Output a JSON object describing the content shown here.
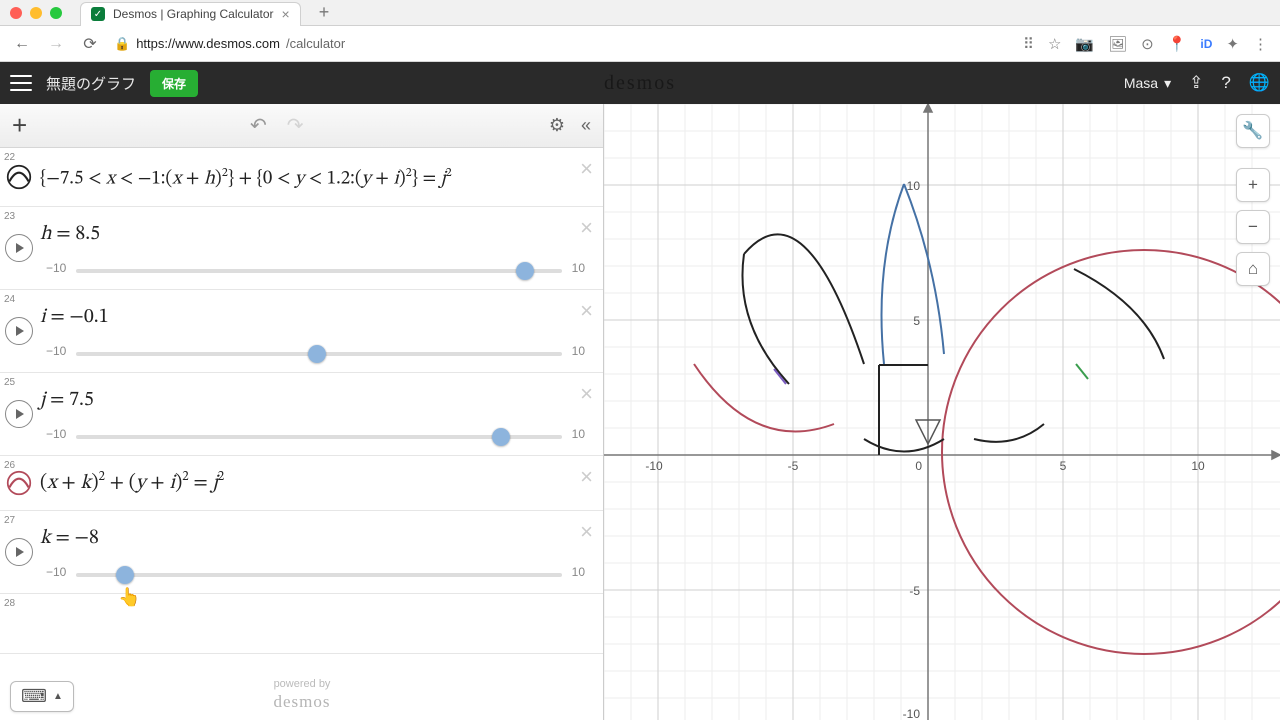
{
  "browser": {
    "tab_title": "Desmos | Graphing Calculator",
    "url_host": "https://www.desmos.com",
    "url_path": "/calculator"
  },
  "header": {
    "untitled": "無題のグラフ",
    "save": "保存",
    "brand": "desmos",
    "user": "Masa"
  },
  "toolbar": {
    "add": "+"
  },
  "exprs": {
    "row22": {
      "num": "22",
      "latex": "{ −7.5 < x < −1 : (x + h)² } + { 0 < y < 1.2 : (y + i)² } = j²"
    },
    "row23": {
      "num": "23",
      "var": "h",
      "valtext": "h = 8.5",
      "value": 8.5,
      "min": "−10",
      "max": "10"
    },
    "row24": {
      "num": "24",
      "var": "i",
      "valtext": "i = −0.1",
      "value": -0.1,
      "min": "−10",
      "max": "10"
    },
    "row25": {
      "num": "25",
      "var": "j",
      "valtext": "j = 7.5",
      "value": 7.5,
      "min": "−10",
      "max": "10"
    },
    "row26": {
      "num": "26",
      "latex": "(x + k)² + (y + i)² = j²"
    },
    "row27": {
      "num": "27",
      "var": "k",
      "valtext": "k = −8",
      "value": -8,
      "min": "−10",
      "max": "10"
    },
    "row28": {
      "num": "28"
    }
  },
  "axis": {
    "ticks_x": [
      "-10",
      "-5",
      "0",
      "5",
      "10"
    ],
    "ticks_y": [
      "10",
      "5",
      "-5",
      "-10"
    ]
  },
  "footer": {
    "powered": "powered by",
    "brand": "desmos"
  },
  "chart_data": {
    "type": "scatter",
    "title": "",
    "xlabel": "",
    "ylabel": "",
    "xlim": [
      -13,
      14
    ],
    "ylim": [
      -11,
      11
    ],
    "grid": true,
    "series": [
      {
        "name": "circle (row 26)",
        "color": "#b24a5a",
        "equation": "(x-8)^2 + (y-0.1)^2 = 7.5^2",
        "params": {
          "cx": 8,
          "cy": 0.1,
          "r": 7.5
        }
      },
      {
        "name": "piecewise curves (row 22)",
        "color": "#2a2a2a",
        "equation": "{-7.5<x<-1:(x+8.5)^2}+{0<y<1.2:(y-0.1)^2}=7.5^2"
      }
    ],
    "params": {
      "h": 8.5,
      "i": -0.1,
      "j": 7.5,
      "k": -8
    }
  }
}
